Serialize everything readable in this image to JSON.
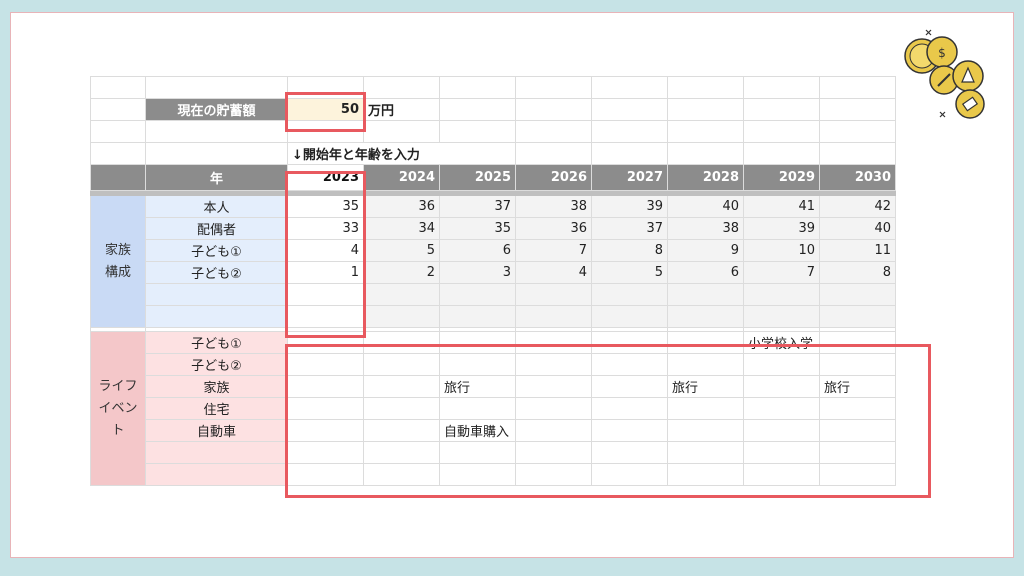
{
  "savings": {
    "label": "現在の貯蓄額",
    "value": "50",
    "unit": "万円"
  },
  "hint": "↓開始年と年齢を入力",
  "year_header": "年",
  "years": [
    "2023",
    "2024",
    "2025",
    "2026",
    "2027",
    "2028",
    "2029",
    "2030"
  ],
  "family": {
    "group_label": "家族\n構成",
    "rows": [
      {
        "label": "本人",
        "values": [
          "35",
          "36",
          "37",
          "38",
          "39",
          "40",
          "41",
          "42"
        ]
      },
      {
        "label": "配偶者",
        "values": [
          "33",
          "34",
          "35",
          "36",
          "37",
          "38",
          "39",
          "40"
        ]
      },
      {
        "label": "子ども①",
        "values": [
          "4",
          "5",
          "6",
          "7",
          "8",
          "9",
          "10",
          "11"
        ]
      },
      {
        "label": "子ども②",
        "values": [
          "1",
          "2",
          "3",
          "4",
          "5",
          "6",
          "7",
          "8"
        ]
      },
      {
        "label": "",
        "values": [
          "",
          "",
          "",
          "",
          "",
          "",
          "",
          ""
        ]
      },
      {
        "label": "",
        "values": [
          "",
          "",
          "",
          "",
          "",
          "",
          "",
          ""
        ]
      }
    ]
  },
  "life": {
    "group_label": "ライフ\nイベント",
    "rows": [
      {
        "label": "子ども①",
        "values": [
          "",
          "",
          "",
          "",
          "",
          "",
          "小学校入学",
          ""
        ]
      },
      {
        "label": "子ども②",
        "values": [
          "",
          "",
          "",
          "",
          "",
          "",
          "",
          ""
        ]
      },
      {
        "label": "家族",
        "values": [
          "",
          "",
          "旅行",
          "",
          "",
          "旅行",
          "",
          "旅行"
        ]
      },
      {
        "label": "住宅",
        "values": [
          "",
          "",
          "",
          "",
          "",
          "",
          "",
          ""
        ]
      },
      {
        "label": "自動車",
        "values": [
          "",
          "",
          "自動車購入",
          "",
          "",
          "",
          "",
          ""
        ]
      },
      {
        "label": "",
        "values": [
          "",
          "",
          "",
          "",
          "",
          "",
          "",
          ""
        ]
      },
      {
        "label": "",
        "values": [
          "",
          "",
          "",
          "",
          "",
          "",
          "",
          ""
        ]
      }
    ]
  },
  "colors": {
    "highlight": "#e8595f",
    "header": "#8c8c8c",
    "family": "#c9daf5",
    "life": "#f4c7c9",
    "background": "#c6e3e6"
  },
  "icons": [
    "coins-icon",
    "pencil-icon",
    "pen-icon",
    "syringe-icon"
  ]
}
